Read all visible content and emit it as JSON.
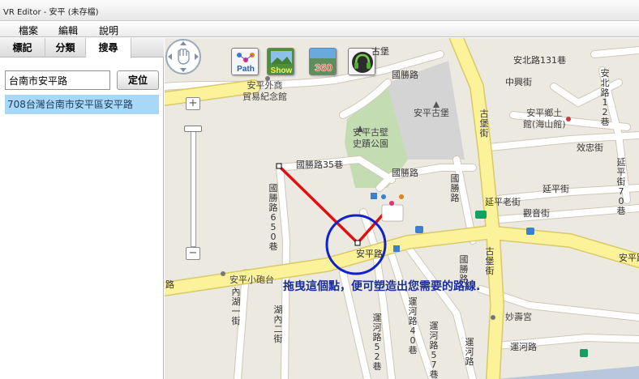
{
  "window": {
    "title": "VR Editor - 安平 (未存檔)"
  },
  "menu": [
    "檔案",
    "編輯",
    "說明"
  ],
  "tabs": [
    "標記",
    "分類",
    "搜尋"
  ],
  "active_tab": "搜尋",
  "search": {
    "value": "台南市安平路",
    "button": "定位"
  },
  "results": [
    "708台灣台南市安平區安平路"
  ],
  "toolbar": {
    "path_label": "Path",
    "show_label": "Show",
    "vr360_label": "360",
    "buttons": [
      "path-icon",
      "show-icon",
      "360-icon",
      "audio-icon"
    ]
  },
  "zoom": {
    "plus": "+",
    "minus": "−"
  },
  "map": {
    "streets": {
      "anping_road": "安平路",
      "anping_road_right": "安平路",
      "guosheng_road_top": "國勝路",
      "guosheng_road_mid": "國勝路",
      "guosheng_35": "國勝路35巷",
      "gubao_top": "古堡街",
      "gubao_bottom": "古堡街",
      "zhongxing": "中興街",
      "xiaozhong": "效忠街",
      "yanping": "延平街",
      "yanping_old": "延平老街",
      "guanyin": "觀音街",
      "yanping_70": "延平街70巷",
      "anbei_131": "安北路131巷",
      "anbei_12": "安北路12巷",
      "anping_road_left": "路",
      "guosheng_650": "國勝路650巷",
      "guosheng_v": "國勝路",
      "neihu_1": "內湖一街",
      "neihu_2": "湖內二街",
      "yunhe_40": "運河路40巷",
      "yunhe_52": "運河路52巷",
      "yunhe_57": "運河路57巷",
      "yunhe_h": "運河路",
      "yunhe_v": "運河路",
      "guo_top": "古堡"
    },
    "pois": {
      "anping_fort": "安平古堡",
      "fort_wall": "安平古壁\n史蹟公園",
      "trade_hall": "安平外商\n貿易紀念館",
      "pillbox": "安平小砲台",
      "anping_hall": "安平鄉土\n館(海山館)",
      "miaoshou": "妙壽宮"
    },
    "annotation": "拖曳這個點，便可塑造出您需要的路線."
  },
  "colors": {
    "route": "#e01010",
    "circle": "#1022c8",
    "main_road": "#fcf29a",
    "road_border": "#d9c968",
    "minor_road": "#ffffff",
    "park": "#c4dcb2",
    "fort_area": "#d4d4d4",
    "result_bg": "#a8d8f5",
    "annotation": "#1c2d9c"
  }
}
